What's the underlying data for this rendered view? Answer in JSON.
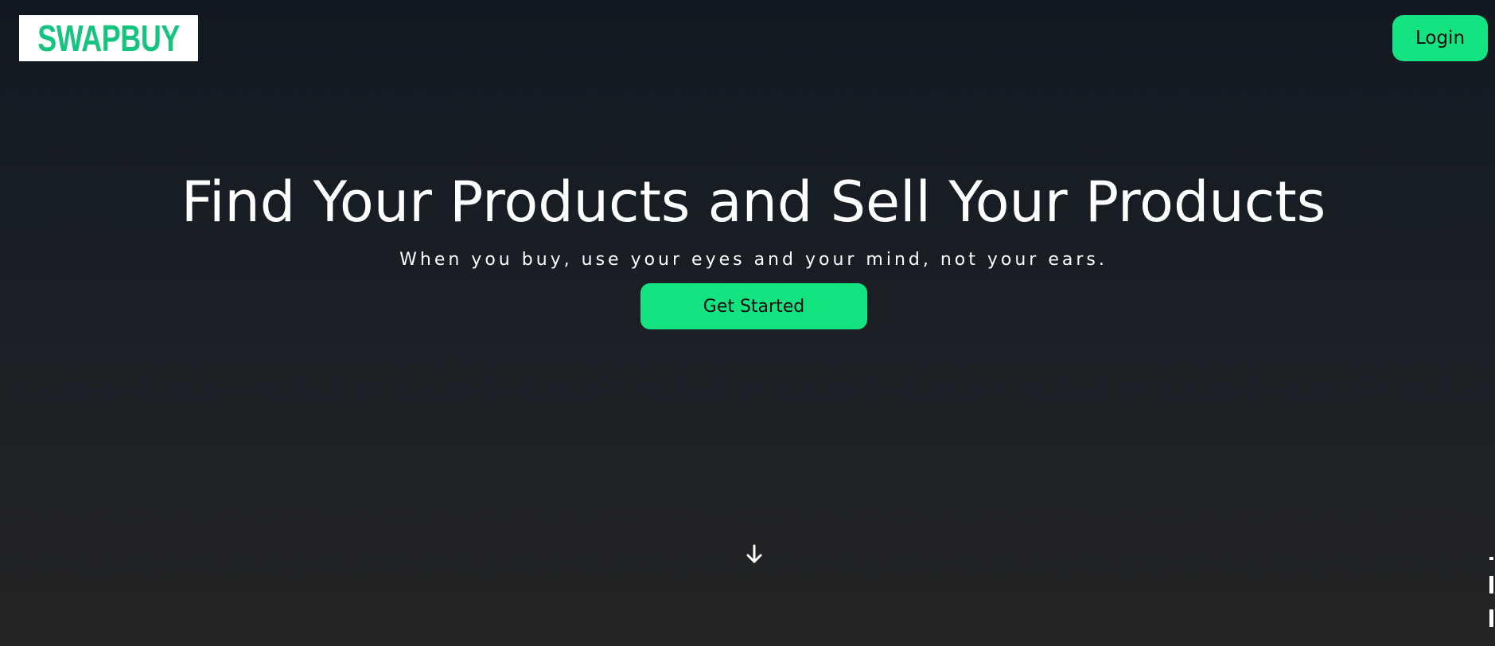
{
  "brand": {
    "logo_text": "SWAPBUY",
    "accent_color": "#14e382",
    "logo_color": "#16c47f"
  },
  "header": {
    "login_label": "Login"
  },
  "hero": {
    "title": "Find Your Products and Sell Your Products",
    "subtitle": "When you buy, use your eyes and your mind, not your ears.",
    "cta_label": "Get Started"
  },
  "scroll_indicator": {
    "icon": "arrow-down-icon"
  }
}
